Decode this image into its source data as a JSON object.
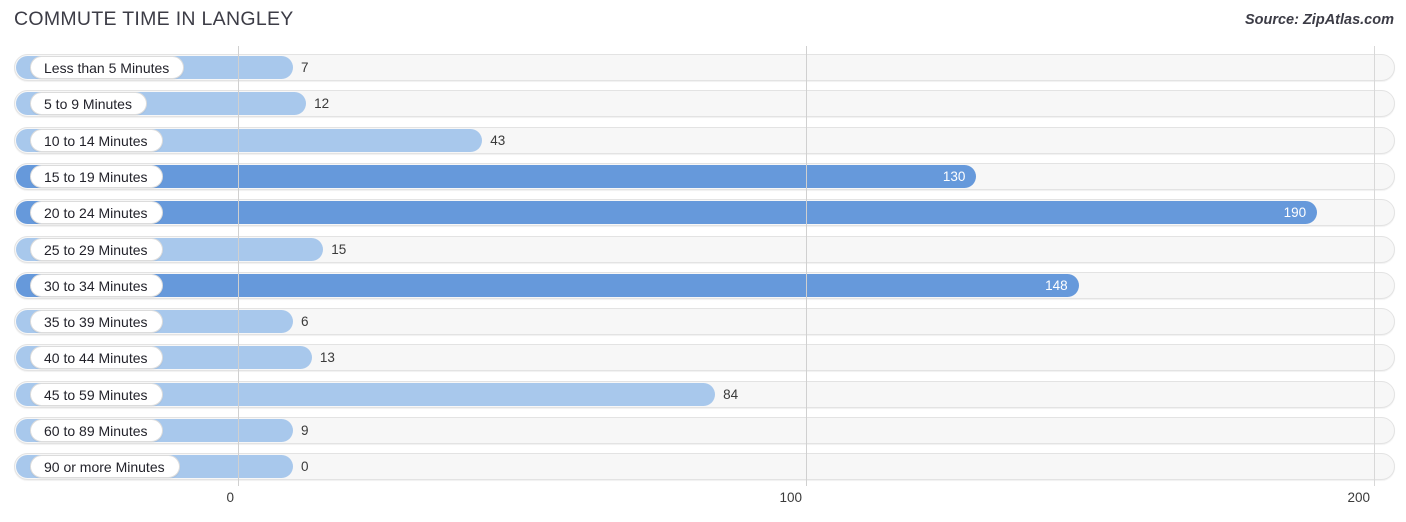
{
  "header": {
    "title": "COMMUTE TIME IN LANGLEY",
    "source": "Source: ZipAtlas.com"
  },
  "colors": {
    "bar_dark": "#6699db",
    "bar_light": "#a8c8ec",
    "track_bg": "#f7f7f7",
    "track_border": "#e3e3e3",
    "gridline": "#d0d0d0",
    "label_text": "#23232b",
    "value_text_outside": "#3a3a3a",
    "value_text_inside": "#ffffff",
    "title_text": "#3c3c46"
  },
  "chart_data": {
    "type": "bar",
    "orientation": "horizontal",
    "title": "COMMUTE TIME IN LANGLEY",
    "xlabel": "",
    "ylabel": "",
    "xlim": [
      0,
      200
    ],
    "xticks": [
      0,
      100,
      200
    ],
    "xtick_labels": [
      "0",
      "100",
      "200"
    ],
    "grid": true,
    "legend": false,
    "categories": [
      "Less than 5 Minutes",
      "5 to 9 Minutes",
      "10 to 14 Minutes",
      "15 to 19 Minutes",
      "20 to 24 Minutes",
      "25 to 29 Minutes",
      "30 to 34 Minutes",
      "35 to 39 Minutes",
      "40 to 44 Minutes",
      "45 to 59 Minutes",
      "60 to 89 Minutes",
      "90 or more Minutes"
    ],
    "values": [
      7,
      12,
      43,
      130,
      190,
      15,
      148,
      6,
      13,
      84,
      9,
      0
    ],
    "value_labels": [
      "7",
      "12",
      "43",
      "130",
      "190",
      "15",
      "148",
      "6",
      "13",
      "84",
      "9",
      "0"
    ]
  }
}
